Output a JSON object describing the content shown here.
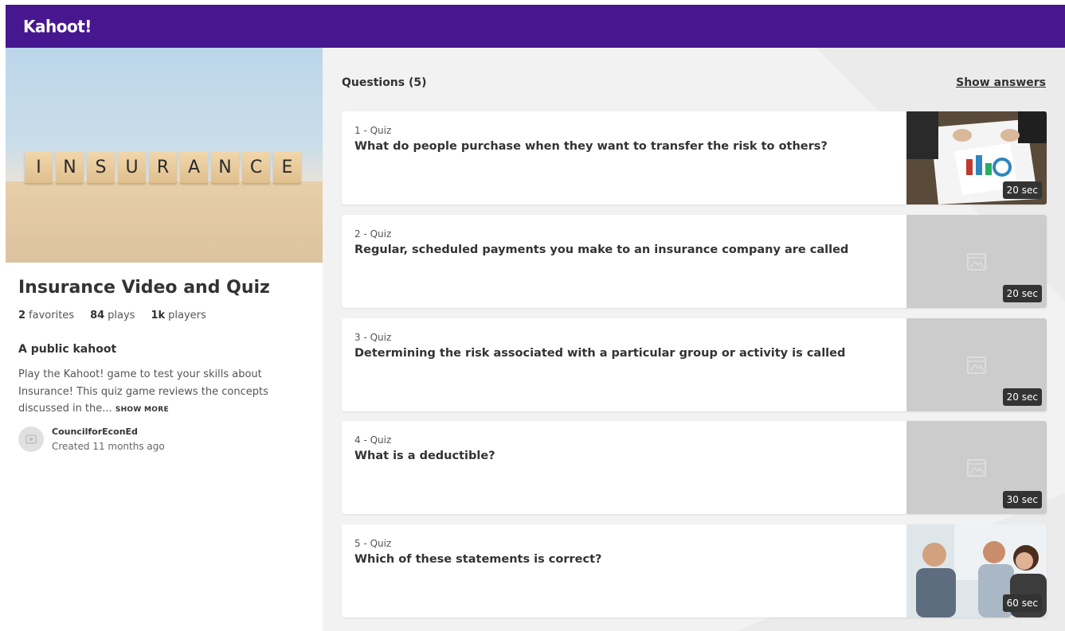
{
  "header": {
    "logo_text": "Kahoot!",
    "brand_color": "#46178f"
  },
  "cover": {
    "tile_letters": [
      "I",
      "N",
      "S",
      "U",
      "R",
      "A",
      "N",
      "C",
      "E"
    ]
  },
  "kahoot": {
    "title": "Insurance Video and Quiz",
    "favorites_count": "2",
    "favorites_label": "favorites",
    "plays_count": "84",
    "plays_label": "plays",
    "players_count": "1k",
    "players_label": "players",
    "visibility": "A public kahoot",
    "description": "Play the Kahoot! game to test your skills about Insurance! This quiz game reviews the concepts discussed in the...",
    "show_more": "SHOW MORE",
    "creator_name": "CouncilforEconEd",
    "created": "Created 11 months ago"
  },
  "questions": {
    "title": "Questions (5)",
    "show_answers": "Show answers",
    "items": [
      {
        "type": "1 - Quiz",
        "text": "What do people purchase when they want to transfer the risk to others?",
        "time": "20 sec",
        "media": "photo-documents"
      },
      {
        "type": "2 - Quiz",
        "text": "Regular, scheduled payments you make to an insurance company are called",
        "time": "20 sec",
        "media": "image-placeholder"
      },
      {
        "type": "3 - Quiz",
        "text": "Determining the risk associated with a particular group or activity is called",
        "time": "20 sec",
        "media": "image-placeholder"
      },
      {
        "type": "4 - Quiz",
        "text": "What is a deductible?",
        "time": "30 sec",
        "media": "image-placeholder"
      },
      {
        "type": "5 - Quiz",
        "text": "Which of these statements is correct?",
        "time": "60 sec",
        "media": "photo-meeting"
      }
    ]
  }
}
